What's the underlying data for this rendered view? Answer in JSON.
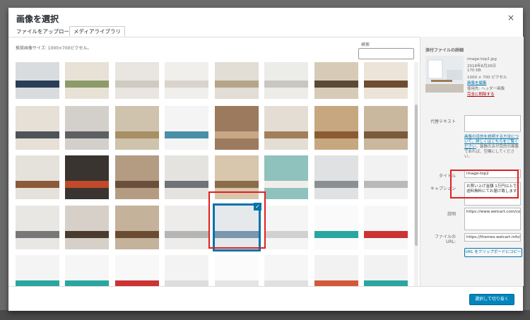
{
  "dialog": {
    "title": "画像を選択",
    "close_icon": "×",
    "tabs": [
      "ファイルをアップロード",
      "メディアライブラリ"
    ],
    "recommended_size": "推奨画像サイズ: 1000×700ピクセル。",
    "search_label": "検索"
  },
  "attachment": {
    "heading": "添付ファイルの詳細",
    "filename": "image-top2.jpg",
    "date": "2018年6月26日",
    "filesize": "170 KB",
    "dimensions": "1000 × 700 ピクセル",
    "edit_link": "画像を編集",
    "used_in": "使用先: ヘッダー画像",
    "delete_link": "完全に削除する"
  },
  "fields": {
    "alt_label": "代替テキスト",
    "alt_value": "",
    "alt_help_link": "画像の目的を説明する方法について。詳しくはこちらをご覧ください",
    "alt_help_text": "。装飾のみが目的の画像であれば、空欄にしてください。",
    "title_label": "タイトル",
    "title_value": "image-top2",
    "caption_label": "キャプション",
    "caption_value": "お買い上げ金額 1万円以上で送料無料にてお届け致します",
    "description_label": "説明",
    "description_value": "https://www.welcart.com/community/forums",
    "url_label": "ファイルの URL:",
    "url_value": "https://themes.welcart.info/",
    "copy_button": "URL をクリップボードにコピー"
  },
  "footer": {
    "select_button": "選択して切り抜く"
  },
  "thumbnails": [
    {
      "row": 0,
      "col": 0,
      "bg": "#d9dcdf",
      "accent": "#2c3e57"
    },
    {
      "row": 0,
      "col": 1,
      "bg": "#e8e2d6",
      "accent": "#8d9a6a"
    },
    {
      "row": 0,
      "col": 2,
      "bg": "#e9e6e1",
      "accent": "#cfcac2"
    },
    {
      "row": 0,
      "col": 3,
      "bg": "#f1efeb",
      "accent": "#d8d4cd"
    },
    {
      "row": 0,
      "col": 4,
      "bg": "#e2ddd5",
      "accent": "#b6a58a"
    },
    {
      "row": 0,
      "col": 5,
      "bg": "#ecece9",
      "accent": "#c9c7c2"
    },
    {
      "row": 0,
      "col": 6,
      "bg": "#d7cbb7",
      "accent": "#5a4a35"
    },
    {
      "row": 0,
      "col": 7,
      "bg": "#ece4d8",
      "accent": "#6e4c32"
    },
    {
      "row": 1,
      "col": 0,
      "bg": "#e6e0d7",
      "accent": "#4d5358"
    },
    {
      "row": 1,
      "col": 1,
      "bg": "#d3d0cc",
      "accent": "#5d5f62"
    },
    {
      "row": 1,
      "col": 2,
      "bg": "#cfc3ad",
      "accent": "#a88f65"
    },
    {
      "row": 1,
      "col": 3,
      "bg": "#f4f4f4",
      "accent": "#4a8fa8"
    },
    {
      "row": 1,
      "col": 4,
      "bg": "#9c7a5e",
      "accent": "#c8a787"
    },
    {
      "row": 1,
      "col": 5,
      "bg": "#e4ddd3",
      "accent": "#a27e5a"
    },
    {
      "row": 1,
      "col": 6,
      "bg": "#c7a77f",
      "accent": "#8b5c34"
    },
    {
      "row": 1,
      "col": 7,
      "bg": "#c9b79e",
      "accent": "#7a5a3a"
    },
    {
      "row": 2,
      "col": 0,
      "bg": "#e5e1db",
      "accent": "#8a5a3a"
    },
    {
      "row": 2,
      "col": 1,
      "bg": "#3a3430",
      "accent": "#c04a2a"
    },
    {
      "row": 2,
      "col": 2,
      "bg": "#b49c83",
      "accent": "#6a4f3a"
    },
    {
      "row": 2,
      "col": 3,
      "bg": "#e5e3e0",
      "accent": "#707478"
    },
    {
      "row": 2,
      "col": 4,
      "bg": "#d8c6ad",
      "accent": "#8a6c4b"
    },
    {
      "row": 2,
      "col": 5,
      "bg": "#8fc1bd",
      "accent": "#f0eee9"
    },
    {
      "row": 2,
      "col": 6,
      "bg": "#dfe1e2",
      "accent": "#8c8f92"
    },
    {
      "row": 2,
      "col": 7,
      "bg": "#f2f2f2",
      "accent": "#b9b9b9"
    },
    {
      "row": 3,
      "col": 0,
      "bg": "#e9e7e3",
      "accent": "#777"
    },
    {
      "row": 3,
      "col": 1,
      "bg": "#d6d0c9",
      "accent": "#4a3a30"
    },
    {
      "row": 3,
      "col": 2,
      "bg": "#c4b29b",
      "accent": "#6a4c33"
    },
    {
      "row": 3,
      "col": 3,
      "bg": "#eeecea",
      "accent": "#b5b5b5"
    },
    {
      "row": 3,
      "col": 4,
      "bg": "#e6e9ec",
      "accent": "#7a96ad"
    },
    {
      "row": 3,
      "col": 5,
      "bg": "#f5f5f5",
      "accent": "#d1d1d1"
    },
    {
      "row": 3,
      "col": 6,
      "bg": "#fafafa",
      "accent": "#2aa6a0"
    },
    {
      "row": 3,
      "col": 7,
      "bg": "#f7f7f7",
      "accent": "#c33"
    },
    {
      "row": 4,
      "col": 0,
      "bg": "#f4f4f4",
      "accent": "#2aa6a0"
    },
    {
      "row": 4,
      "col": 1,
      "bg": "#f6f6f6",
      "accent": "#2aa6a0"
    },
    {
      "row": 4,
      "col": 2,
      "bg": "#f8f8f8",
      "accent": "#c33"
    },
    {
      "row": 4,
      "col": 3,
      "bg": "#f3f3f3",
      "accent": "#ddd"
    },
    {
      "row": 4,
      "col": 4,
      "bg": "#fbfbfb",
      "accent": "#e5e5e5"
    },
    {
      "row": 4,
      "col": 5,
      "bg": "#f6f6f6",
      "accent": "#e0e0e0"
    },
    {
      "row": 4,
      "col": 6,
      "bg": "#f2f2f2",
      "accent": "#d25a3a"
    },
    {
      "row": 4,
      "col": 7,
      "bg": "#f2f2f2",
      "accent": "#2aa6a0"
    }
  ],
  "selected_index": 28,
  "colors": {
    "accent": "#0073aa",
    "button": "#0085ba",
    "highlight": "#e02020"
  }
}
